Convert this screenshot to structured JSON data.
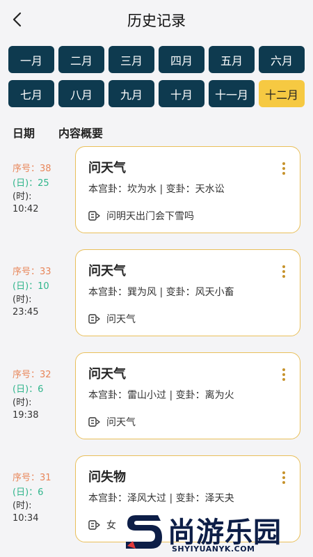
{
  "header": {
    "title": "历史记录"
  },
  "months": [
    "一月",
    "二月",
    "三月",
    "四月",
    "五月",
    "六月",
    "七月",
    "八月",
    "九月",
    "十月",
    "十一月",
    "十二月"
  ],
  "active_month": "十二月",
  "columns": {
    "date": "日期",
    "summary": "内容概要"
  },
  "entries": [
    {
      "seq": "序号：38",
      "day": "(日)：25",
      "time_label": "(时):",
      "time": "10:42",
      "title": "问天气",
      "gua": "本宫卦：坎为水 | 变卦：天水讼",
      "question": "问明天出门会下雪吗"
    },
    {
      "seq": "序号：33",
      "day": "(日)：10",
      "time_label": "(时):",
      "time": "23:45",
      "title": "问天气",
      "gua": "本宫卦：巽为风 | 变卦：风天小畜",
      "question": "问天气"
    },
    {
      "seq": "序号：32",
      "day": "(日)：6",
      "time_label": "(时):",
      "time": "19:38",
      "title": "问天气",
      "gua": "本宫卦：雷山小过 | 变卦：离为火",
      "question": "问天气"
    },
    {
      "seq": "序号：31",
      "day": "(日)：6",
      "time_label": "(时):",
      "time": "10:34",
      "title": "问失物",
      "gua": "本宫卦：泽风大过 | 变卦：泽天夬",
      "question": "女"
    }
  ],
  "watermark": {
    "text": "尚游乐园",
    "url": "SHYIYUANYK.COM"
  },
  "colors": {
    "month_bg": "#0e3a4f",
    "month_active": "#f6c942",
    "card_border": "#e9bf59",
    "seq": "#e8865a",
    "day": "#2fb58b"
  }
}
